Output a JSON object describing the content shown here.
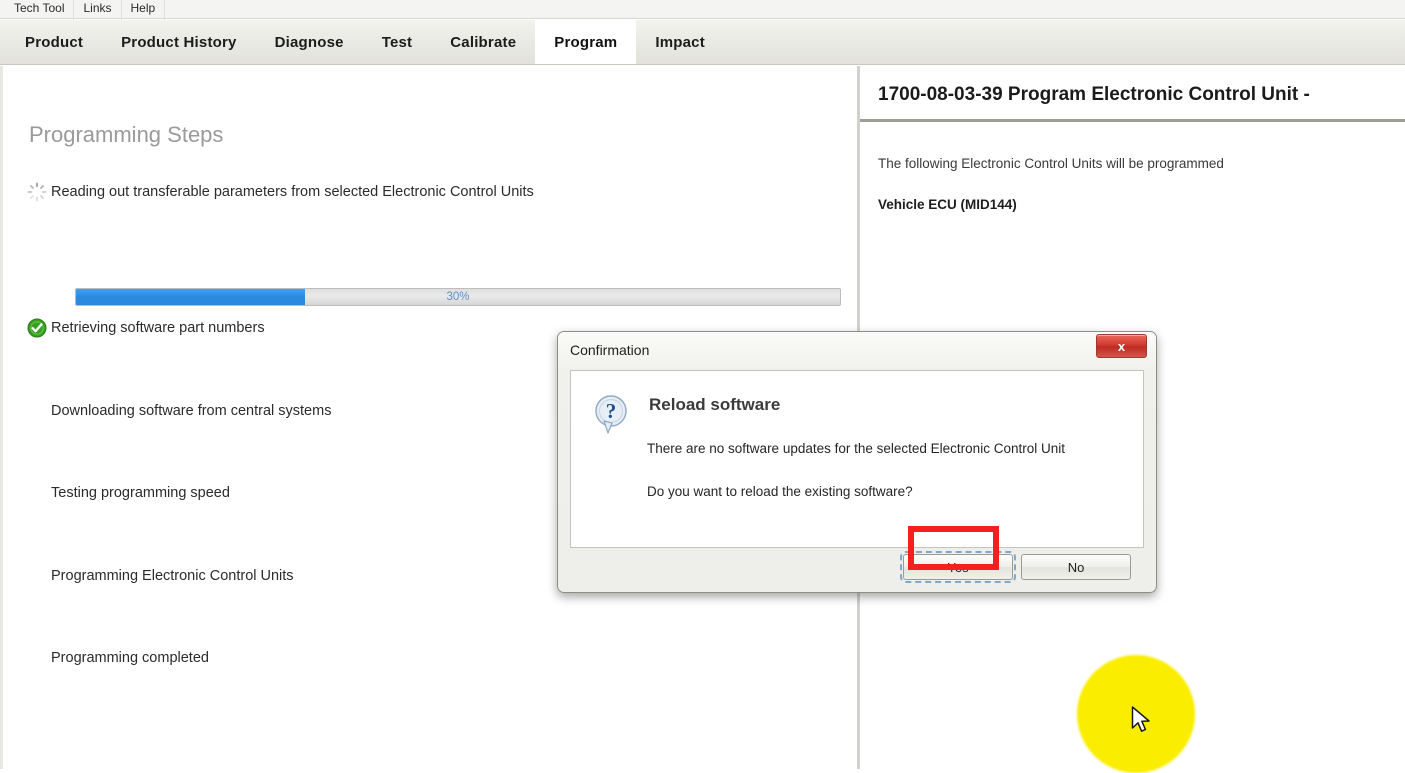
{
  "menubar": {
    "items": [
      {
        "label": "Tech Tool",
        "name": "menu-item-tech-tool"
      },
      {
        "label": "Links",
        "name": "menu-item-links"
      },
      {
        "label": "Help",
        "name": "menu-item-help"
      }
    ]
  },
  "tabs": [
    {
      "label": "Product",
      "active": false
    },
    {
      "label": "Product History",
      "active": false
    },
    {
      "label": "Diagnose",
      "active": false
    },
    {
      "label": "Test",
      "active": false
    },
    {
      "label": "Calibrate",
      "active": false
    },
    {
      "label": "Program",
      "active": true
    },
    {
      "label": "Impact",
      "active": false
    }
  ],
  "left_panel": {
    "title": "Programming Steps",
    "steps": [
      {
        "label": "Reading out transferable parameters from selected Electronic Control Units",
        "state": "running",
        "icon": "spinner-icon"
      },
      {
        "label": "Retrieving software part numbers",
        "state": "done",
        "icon": "check-circle-icon"
      },
      {
        "label": "Downloading software from central systems",
        "state": "pending",
        "icon": ""
      },
      {
        "label": "Testing programming speed",
        "state": "pending",
        "icon": ""
      },
      {
        "label": "Programming Electronic Control Units",
        "state": "pending",
        "icon": ""
      },
      {
        "label": "Programming completed",
        "state": "pending",
        "icon": ""
      }
    ],
    "progress": {
      "percent_label": "30%",
      "percent_value": 30,
      "fill_color": "#2b8ade",
      "track_color": "#e3e3e3"
    }
  },
  "right_panel": {
    "title": "1700-08-03-39 Program Electronic Control Unit -",
    "line1": "The following Electronic Control Units will be programmed",
    "line2": "Vehicle ECU (MID144)"
  },
  "dialog": {
    "title": "Confirmation",
    "close_label": "x",
    "icon": "question-icon",
    "heading": "Reload software",
    "text1": "There are no software updates for the selected Electronic Control Unit",
    "text2": "Do you want to reload the existing software?",
    "buttons": [
      {
        "label": "Yes",
        "focused": true,
        "highlighted": true
      },
      {
        "label": "No",
        "focused": false,
        "highlighted": false
      }
    ]
  },
  "annotations": {
    "highlight_color": "#f41f1f",
    "cursor_highlight_color": "#fbed00"
  }
}
